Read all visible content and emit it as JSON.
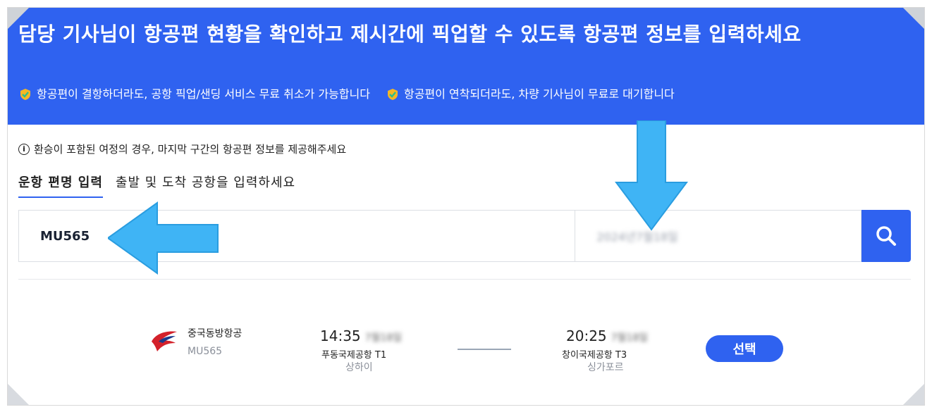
{
  "banner": {
    "title": "담당 기사님이 항공편 현황을 확인하고 제시간에 픽업할 수 있도록 항공편 정보를 입력하세요",
    "benefits": [
      {
        "icon": "shield-check-icon",
        "text": "항공편이 결항하더라도, 공항 픽업/샌딩 서비스 무료 취소가 가능합니다"
      },
      {
        "icon": "shield-check-icon",
        "text": "항공편이 연착되더라도, 차량 기사님이 무료로 대기합니다"
      }
    ]
  },
  "notice": {
    "icon": "info-icon",
    "text": "환승이 포함된 여정의 경우, 마지막 구간의 항공편 정보를 제공해주세요"
  },
  "tabs": [
    {
      "label": "운항 편명 입력",
      "active": true
    },
    {
      "label": "출발 및 도착 공항을 입력하세요",
      "active": false
    }
  ],
  "search": {
    "flight_value": "MU565",
    "date_value": "2024년7월18일",
    "button_icon": "search-icon"
  },
  "result": {
    "airline_name": "중국동방항공",
    "flight_code": "MU565",
    "departure": {
      "time": "14:35",
      "date": "7월18일",
      "airport": "푸동국제공항 T1",
      "city": "상하이"
    },
    "arrival": {
      "time": "20:25",
      "date": "7월18일",
      "airport": "창이국제공항 T3",
      "city": "싱가포르"
    },
    "select_label": "선택"
  },
  "colors": {
    "brand": "#2f62f0",
    "arrow": "#3fb4f5"
  }
}
